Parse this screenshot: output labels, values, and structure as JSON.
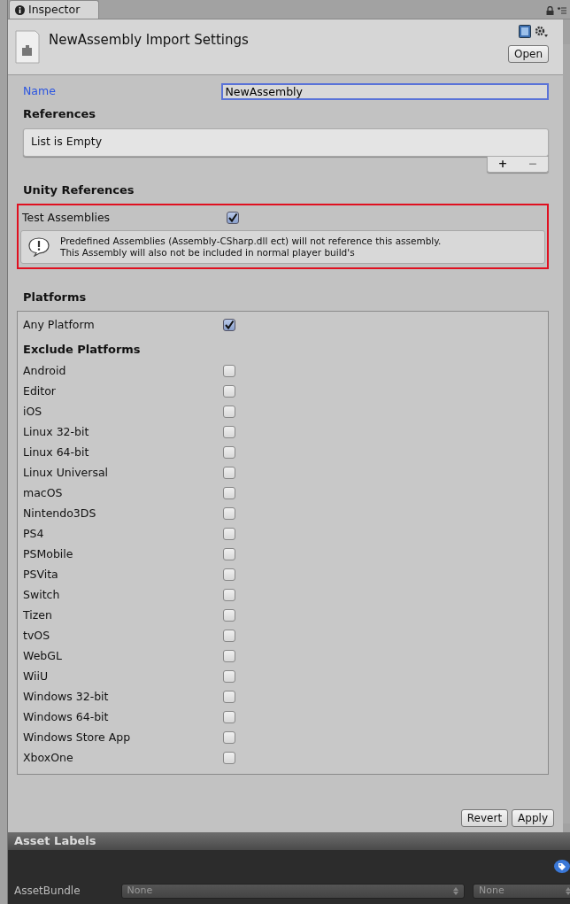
{
  "tab": {
    "label": "Inspector"
  },
  "header": {
    "title": "NewAssembly Import Settings",
    "open_button": "Open"
  },
  "name_field": {
    "label": "Name",
    "value": "NewAssembly"
  },
  "references": {
    "title": "References",
    "empty_text": "List is Empty",
    "add": "+",
    "remove": "−"
  },
  "unity_references": {
    "title": "Unity References",
    "highlighted": true,
    "test_assemblies": {
      "label": "Test Assemblies",
      "checked": true
    },
    "warning": "Predefined Assemblies (Assembly-CSharp.dll ect) will not reference this assembly.\nThis Assembly will also not be included in normal player build's"
  },
  "platforms": {
    "title": "Platforms",
    "any_platform": {
      "label": "Any Platform",
      "checked": true
    },
    "exclude_title": "Exclude Platforms",
    "items": [
      {
        "label": "Android",
        "checked": false
      },
      {
        "label": "Editor",
        "checked": false
      },
      {
        "label": "iOS",
        "checked": false
      },
      {
        "label": "Linux 32-bit",
        "checked": false
      },
      {
        "label": "Linux 64-bit",
        "checked": false
      },
      {
        "label": "Linux Universal",
        "checked": false
      },
      {
        "label": "macOS",
        "checked": false
      },
      {
        "label": "Nintendo3DS",
        "checked": false
      },
      {
        "label": "PS4",
        "checked": false
      },
      {
        "label": "PSMobile",
        "checked": false
      },
      {
        "label": "PSVita",
        "checked": false
      },
      {
        "label": "Switch",
        "checked": false
      },
      {
        "label": "Tizen",
        "checked": false
      },
      {
        "label": "tvOS",
        "checked": false
      },
      {
        "label": "WebGL",
        "checked": false
      },
      {
        "label": "WiiU",
        "checked": false
      },
      {
        "label": "Windows 32-bit",
        "checked": false
      },
      {
        "label": "Windows 64-bit",
        "checked": false
      },
      {
        "label": "Windows Store App",
        "checked": false
      },
      {
        "label": "XboxOne",
        "checked": false
      }
    ]
  },
  "buttons": [
    "Revert",
    "Apply"
  ],
  "asset_labels": {
    "title": "Asset Labels",
    "asset_bundle": {
      "label": "AssetBundle",
      "name": "None",
      "variant": "None"
    }
  }
}
